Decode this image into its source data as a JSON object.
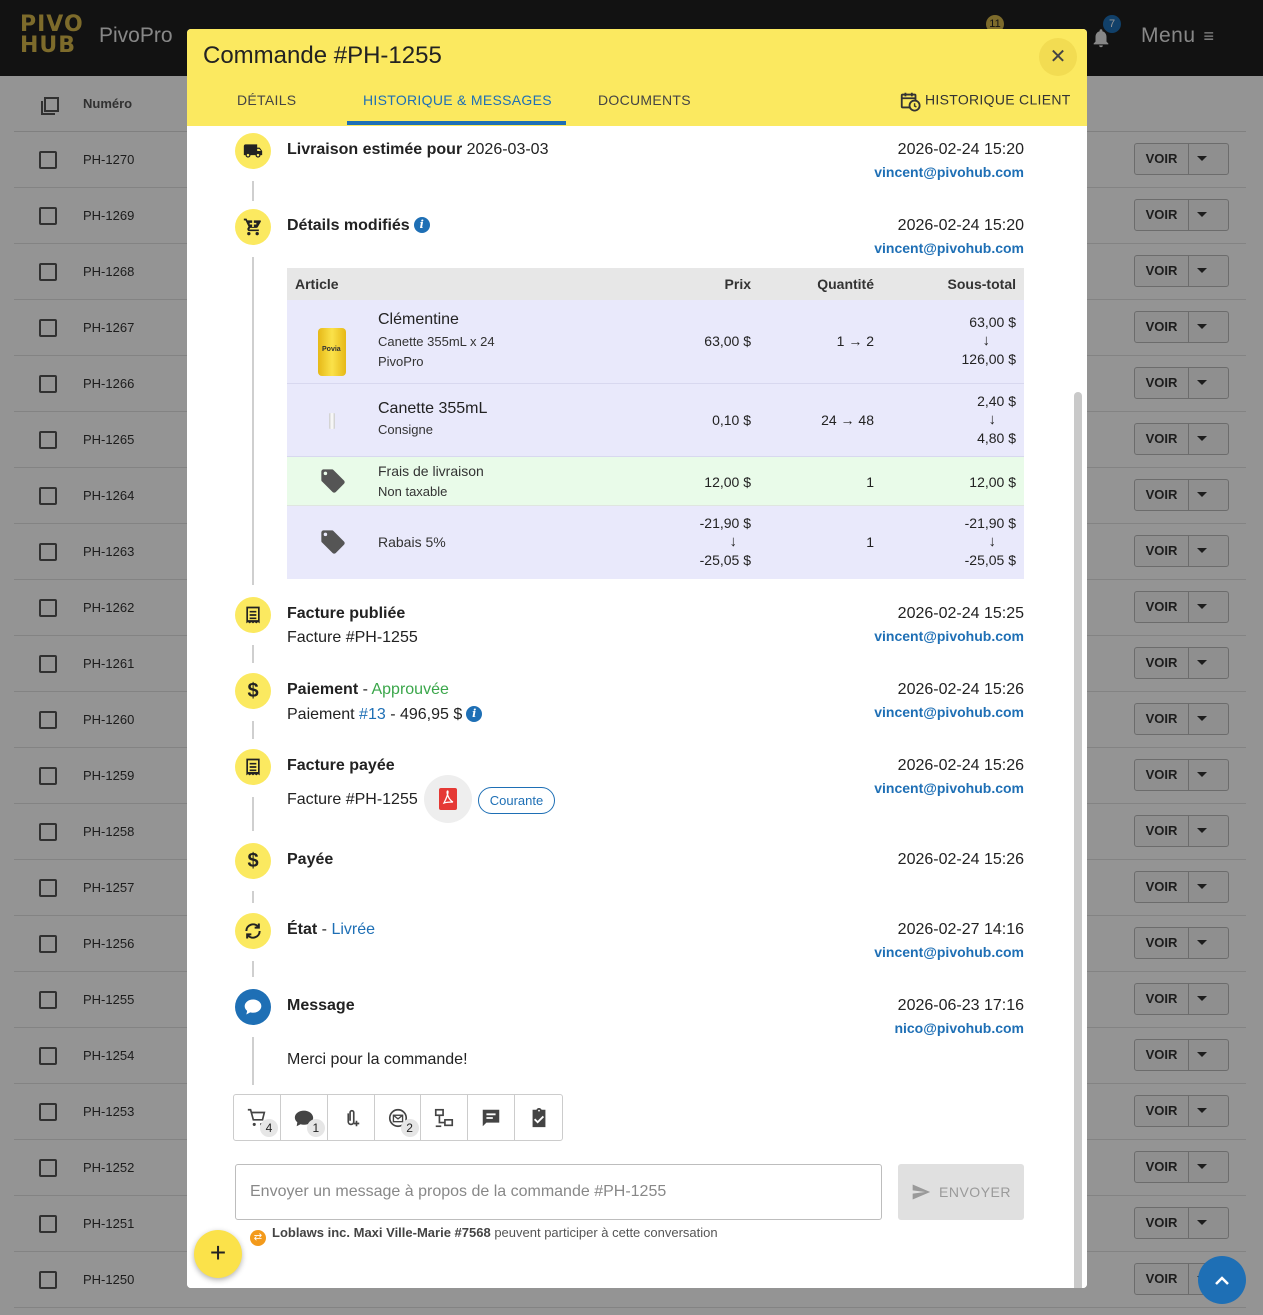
{
  "app": {
    "brand": "PivoPro",
    "menu_label": "Menu",
    "bell_badge": "7",
    "cart_badge": "11",
    "logo_text": "PIVO HUB"
  },
  "bg_table": {
    "col_numero": "Numéro",
    "rows": [
      "PH-1270",
      "PH-1269",
      "PH-1268",
      "PH-1267",
      "PH-1266",
      "PH-1265",
      "PH-1264",
      "PH-1263",
      "PH-1262",
      "PH-1261",
      "PH-1260",
      "PH-1259",
      "PH-1258",
      "PH-1257",
      "PH-1256",
      "PH-1255",
      "PH-1254",
      "PH-1253",
      "PH-1252",
      "PH-1251",
      "PH-1250"
    ],
    "voir_label": "VOIR"
  },
  "modal": {
    "title": "Commande #PH-1255",
    "tabs": [
      "DÉTAILS",
      "HISTORIQUE & MESSAGES",
      "DOCUMENTS"
    ],
    "hist_client": "HISTORIQUE CLIENT"
  },
  "events": {
    "e1": {
      "title": "Livraison estimée pour",
      "value": "2026-03-03",
      "date": "2026-02-24 15:20",
      "user": "vincent@pivohub.com"
    },
    "e2": {
      "title": "Détails modifiés",
      "date": "2026-02-24 15:20",
      "user": "vincent@pivohub.com"
    },
    "e3": {
      "title": "Facture publiée",
      "sub": "Facture #PH-1255",
      "date": "2026-02-24 15:25",
      "user": "vincent@pivohub.com"
    },
    "e4": {
      "title": "Paiement",
      "sep": " - ",
      "status": "Approuvée",
      "sub_prefix": "Paiement ",
      "link": "#13",
      "sub_suffix": " - 496,95 $",
      "date": "2026-02-24 15:26",
      "user": "vincent@pivohub.com"
    },
    "e5": {
      "title": "Facture payée",
      "sub": "Facture #PH-1255",
      "chip": "Courante",
      "date": "2026-02-24 15:26",
      "user": "vincent@pivohub.com"
    },
    "e6": {
      "title": "Payée",
      "date": "2026-02-24 15:26"
    },
    "e7": {
      "title": "État",
      "sep": " - ",
      "status": "Livrée",
      "date": "2026-02-27 14:16",
      "user": "vincent@pivohub.com"
    },
    "e8": {
      "title": "Message",
      "body": "Merci pour la commande!",
      "date": "2026-06-23 17:16",
      "user": "nico@pivohub.com"
    }
  },
  "details_table": {
    "headers": {
      "article": "Article",
      "prix": "Prix",
      "quantite": "Quantité",
      "soustotal": "Sous-total"
    },
    "rows": [
      {
        "name": "Clémentine",
        "sub1": "Canette 355mL x 24",
        "sub2": "PivoPro",
        "price": "63,00 $",
        "qty_from": "1",
        "qty_to": "2",
        "st_from": "63,00 $",
        "st_to": "126,00 $"
      },
      {
        "name": "Canette 355mL",
        "sub1": "Consigne",
        "price": "0,10 $",
        "qty_from": "24",
        "qty_to": "48",
        "st_from": "2,40 $",
        "st_to": "4,80 $"
      },
      {
        "name": "Frais de livraison",
        "sub1": "Non taxable",
        "price": "12,00 $",
        "qty": "1",
        "st": "12,00 $"
      },
      {
        "name": "Rabais 5%",
        "price_from": "-21,90 $",
        "price_to": "-25,05 $",
        "qty": "1",
        "st_from": "-21,90 $",
        "st_to": "-25,05 $"
      }
    ],
    "can_label": "Povia"
  },
  "toolbar": {
    "cart_count": "4",
    "comment_count": "1",
    "email_count": "2"
  },
  "composer": {
    "placeholder": "Envoyer un message à propos de la commande #PH-1255",
    "send_label": "ENVOYER",
    "participants_bold": "Loblaws inc. Maxi Ville-Marie #7568",
    "participants_rest": " peuvent participer à cette conversation"
  },
  "colors": {
    "yellow": "#fbe960",
    "blue": "#1e6fb5",
    "green": "#3aa64a"
  }
}
